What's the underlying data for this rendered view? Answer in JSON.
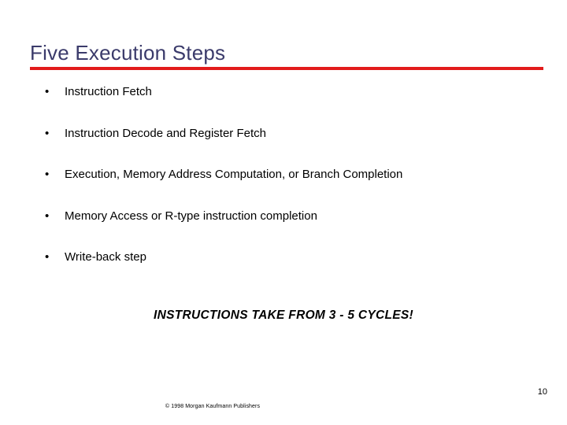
{
  "slide": {
    "title": "Five Execution Steps",
    "accent_color": "#e21b1b",
    "title_color": "#3b3b6b",
    "background_color": "#ffffff",
    "bullet_marker": "•",
    "bullets": [
      {
        "text": "Instruction Fetch"
      },
      {
        "text": "Instruction Decode and Register Fetch"
      },
      {
        "text": "Execution, Memory Address Computation, or Branch Completion"
      },
      {
        "text": "Memory Access or R-type instruction completion"
      },
      {
        "text": "Write-back step"
      }
    ],
    "emphasis": "INSTRUCTIONS TAKE FROM 3 - 5 CYCLES!",
    "footer": {
      "page_number": "10",
      "copyright": "© 1998 Morgan Kaufmann Publishers"
    }
  }
}
